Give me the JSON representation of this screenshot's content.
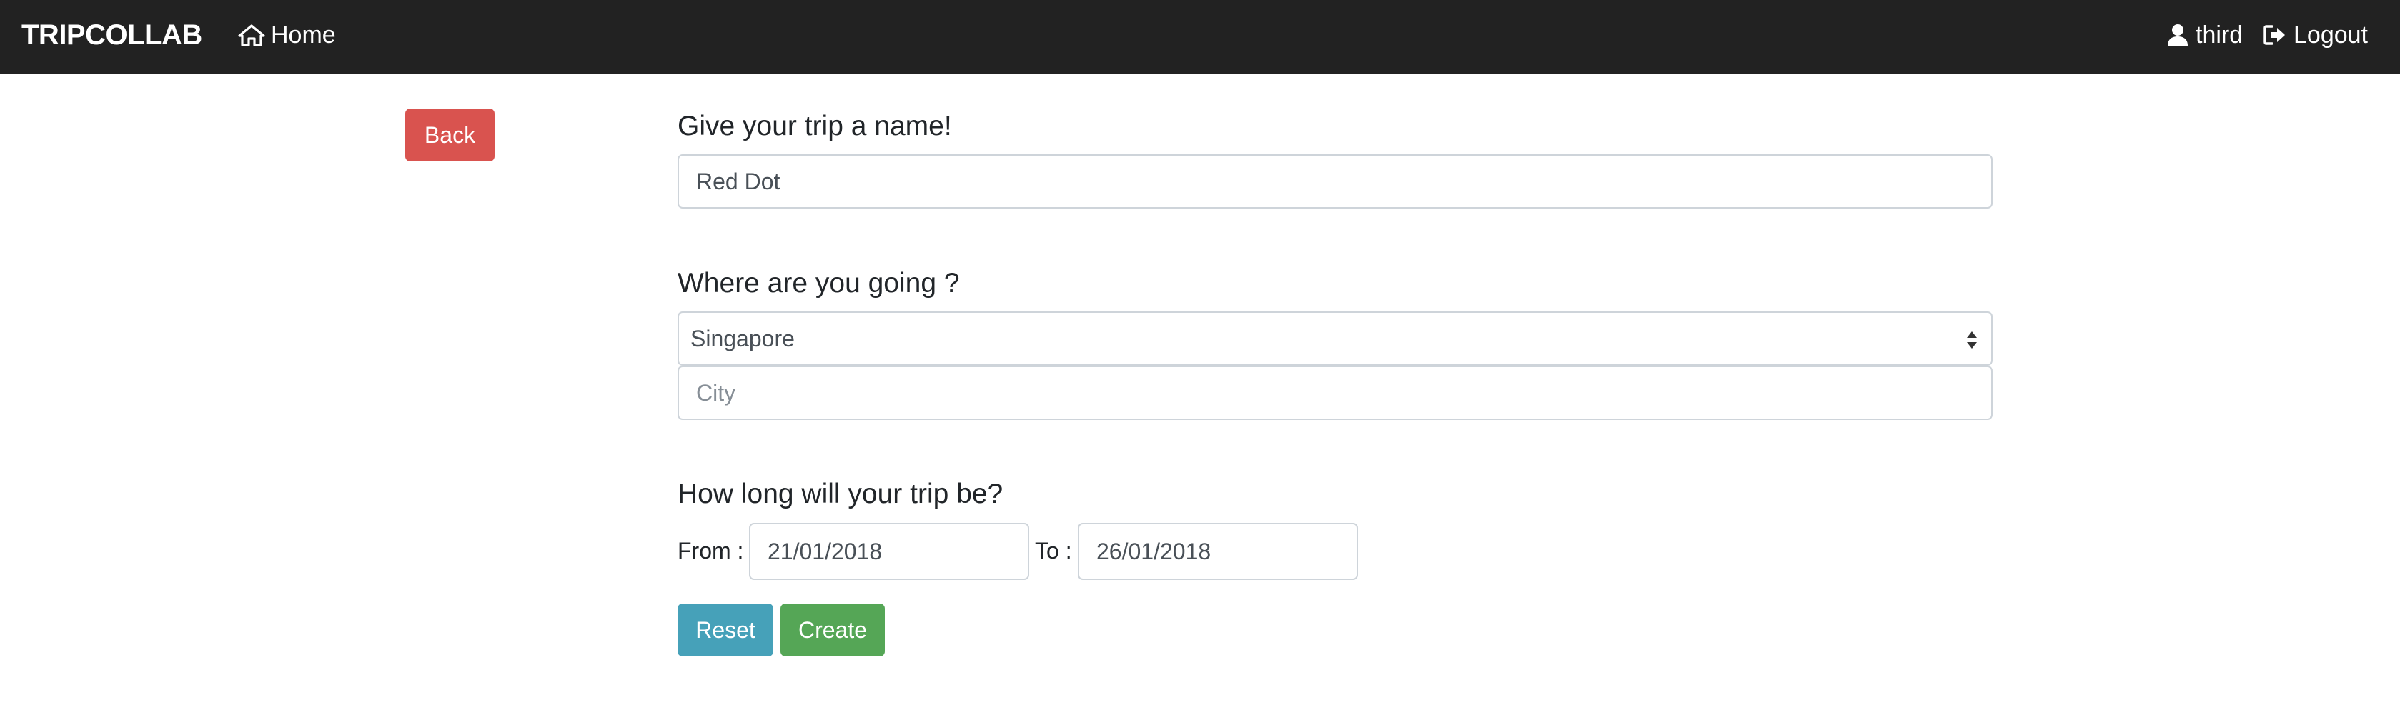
{
  "navbar": {
    "brand": "TRIPCOLLAB",
    "home_label": "Home",
    "home_icon": "home-icon",
    "user_label": "third",
    "user_icon": "user-icon",
    "logout_label": "Logout",
    "logout_icon": "logout-icon",
    "background_color": "#222222"
  },
  "back_button": {
    "label": "Back",
    "color": "#d9534f"
  },
  "form": {
    "name_heading": "Give your trip a name!",
    "name_value": "Red Dot",
    "where_heading": "Where are you going ?",
    "country_selected": "Singapore",
    "city_placeholder": "City",
    "duration_heading": "How long will your trip be?",
    "from_label": "From :",
    "from_value": "21/01/2018",
    "to_label": "To :",
    "to_value": "26/01/2018"
  },
  "actions": {
    "reset_label": "Reset",
    "reset_color": "#46a1b9",
    "create_label": "Create",
    "create_color": "#55a656"
  }
}
